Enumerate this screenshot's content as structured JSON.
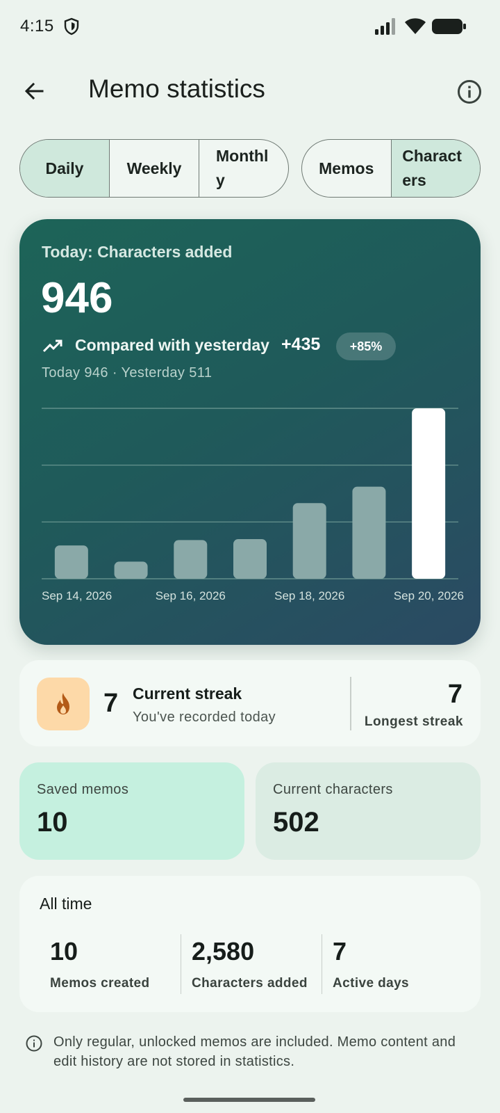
{
  "status_bar": {
    "time": "4:15"
  },
  "app_bar": {
    "title": "Memo statistics"
  },
  "period_tabs": [
    {
      "label": "Daily",
      "selected": true
    },
    {
      "label": "Weekly",
      "selected": false
    },
    {
      "label": "Monthly",
      "selected": false
    }
  ],
  "metric_tabs": [
    {
      "label": "Memos",
      "selected": false
    },
    {
      "label": "Characters",
      "selected": true
    }
  ],
  "hero": {
    "label": "Today: Characters added",
    "value": "946",
    "compare_label": "Compared with yesterday",
    "compare_diff": "+435",
    "compare_percent": "+85%",
    "compare_detail": "Today 946 · Yesterday 511"
  },
  "chart_data": {
    "type": "bar",
    "categories": [
      "Sep 14, 2026",
      "Sep 15, 2026",
      "Sep 16, 2026",
      "Sep 17, 2026",
      "Sep 18, 2026",
      "Sep 19, 2026",
      "Sep 20, 2026"
    ],
    "x_tick_labels": [
      "Sep 14, 2026",
      "Sep 16, 2026",
      "Sep 18, 2026",
      "Sep 20, 2026"
    ],
    "values": [
      185,
      95,
      215,
      220,
      420,
      511,
      946
    ],
    "highlight_index": 6,
    "ylim": [
      0,
      946
    ],
    "grid": true,
    "colors": {
      "bar": "#8aa9a8",
      "highlight": "#ffffff",
      "grid": "#6f9a94"
    }
  },
  "streak": {
    "current_value": "7",
    "current_title": "Current streak",
    "current_sub": "You've recorded today",
    "longest_value": "7",
    "longest_label": "Longest streak"
  },
  "stats": {
    "saved_memos_label": "Saved memos",
    "saved_memos_value": "10",
    "current_chars_label": "Current characters",
    "current_chars_value": "502"
  },
  "all_time": {
    "title": "All time",
    "items": [
      {
        "value": "10",
        "label": "Memos created"
      },
      {
        "value": "2,580",
        "label": "Characters added"
      },
      {
        "value": "7",
        "label": "Active days"
      }
    ]
  },
  "footer_note": "Only regular, unlocked memos are included. Memo content and edit history are not stored in statistics."
}
